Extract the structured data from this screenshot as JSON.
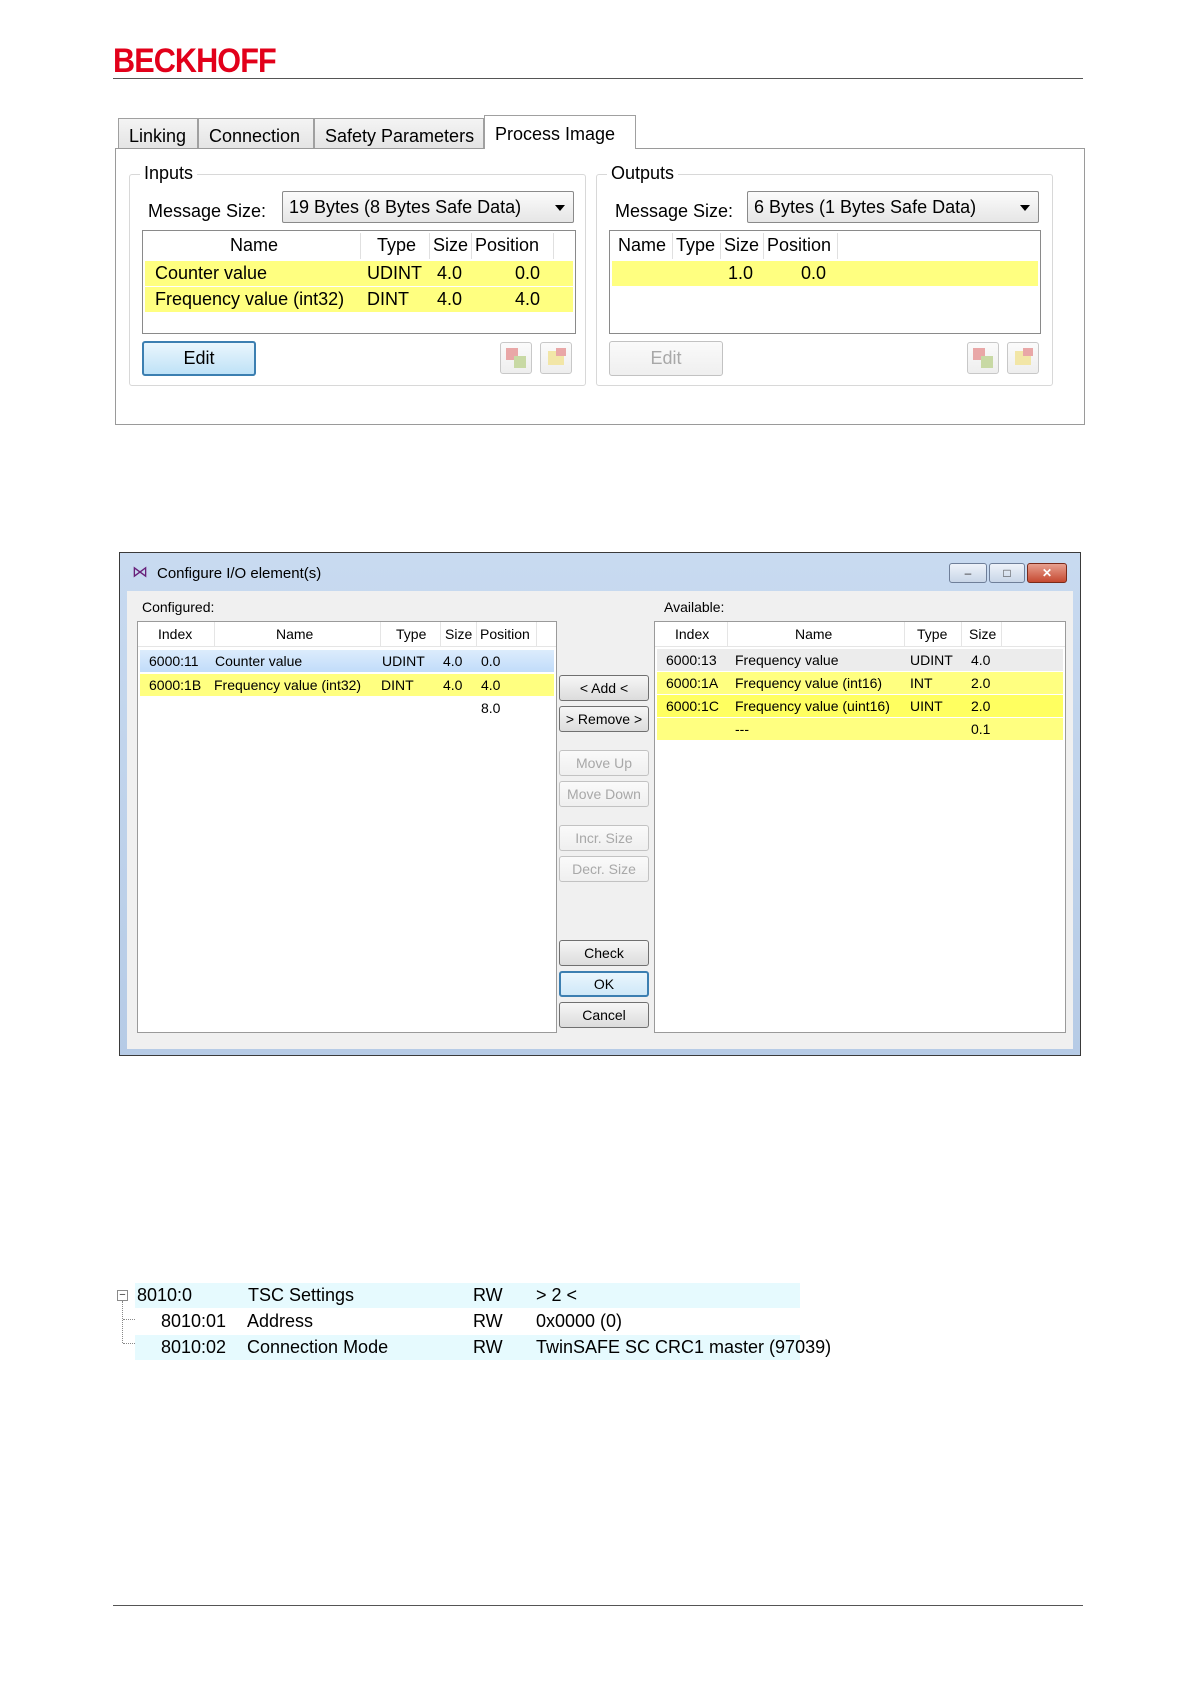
{
  "brand": {
    "logo_text": "BECKHOFF",
    "color": "#e2001a"
  },
  "process_image": {
    "tabs": [
      "Linking",
      "Connection",
      "Safety Parameters",
      "Process Image"
    ],
    "active_tab": "Process Image",
    "inputs": {
      "title": "Inputs",
      "message_size_label": "Message Size:",
      "message_size_value": "19 Bytes (8 Bytes Safe Data)",
      "columns": [
        "Name",
        "Type",
        "Size",
        "Position"
      ],
      "rows": [
        {
          "name": "Counter value",
          "type": "UDINT",
          "size": "4.0",
          "position": "0.0"
        },
        {
          "name": "Frequency value (int32)",
          "type": "DINT",
          "size": "4.0",
          "position": "4.0"
        }
      ],
      "edit_label": "Edit"
    },
    "outputs": {
      "title": "Outputs",
      "message_size_label": "Message Size:",
      "message_size_value": "6 Bytes (1 Bytes Safe Data)",
      "columns": [
        "Name",
        "Type",
        "Size",
        "Position"
      ],
      "rows": [
        {
          "name": "",
          "type": "",
          "size": "1.0",
          "position": "0.0"
        }
      ],
      "edit_label": "Edit"
    }
  },
  "configure_dialog": {
    "title": "Configure I/O element(s)",
    "window_buttons": {
      "minimize": "–",
      "maximize": "□",
      "close": "✕"
    },
    "configured": {
      "label": "Configured:",
      "columns": [
        "Index",
        "Name",
        "Type",
        "Size",
        "Position"
      ],
      "rows": [
        {
          "index": "6000:11",
          "name": "Counter value",
          "type": "UDINT",
          "size": "4.0",
          "position": "0.0"
        },
        {
          "index": "6000:1B",
          "name": "Frequency value (int32)",
          "type": "DINT",
          "size": "4.0",
          "position": "4.0"
        },
        {
          "index": "",
          "name": "",
          "type": "",
          "size": "",
          "position": "8.0"
        }
      ]
    },
    "available": {
      "label": "Available:",
      "columns": [
        "Index",
        "Name",
        "Type",
        "Size"
      ],
      "rows": [
        {
          "index": "6000:13",
          "name": "Frequency value",
          "type": "UDINT",
          "size": "4.0"
        },
        {
          "index": "6000:1A",
          "name": "Frequency value (int16)",
          "type": "INT",
          "size": "2.0"
        },
        {
          "index": "6000:1C",
          "name": "Frequency value (uint16)",
          "type": "UINT",
          "size": "2.0"
        },
        {
          "index": "",
          "name": "---",
          "type": "",
          "size": "0.1"
        }
      ]
    },
    "buttons": {
      "add": "< Add <",
      "remove": "> Remove >",
      "move_up": "Move Up",
      "move_down": "Move Down",
      "incr_size": "Incr. Size",
      "decr_size": "Decr. Size",
      "check": "Check",
      "ok": "OK",
      "cancel": "Cancel"
    }
  },
  "tree": {
    "expander": "−",
    "rows": [
      {
        "index": "8010:0",
        "name": "TSC Settings",
        "access": "RW",
        "value": "> 2 <"
      },
      {
        "index": "8010:01",
        "name": "Address",
        "access": "RW",
        "value": "0x0000 (0)"
      },
      {
        "index": "8010:02",
        "name": "Connection Mode",
        "access": "RW",
        "value": "TwinSAFE SC CRC1 master (97039)"
      }
    ]
  }
}
